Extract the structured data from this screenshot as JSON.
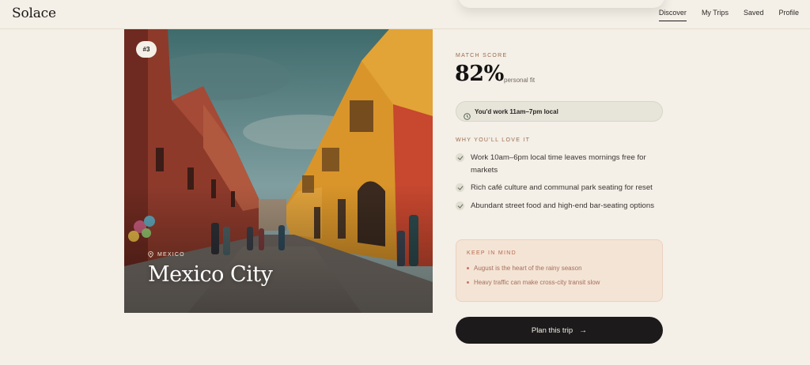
{
  "app": {
    "logo": "Solace"
  },
  "nav": [
    {
      "label": "Discover",
      "active": true
    },
    {
      "label": "My Trips",
      "active": false
    },
    {
      "label": "Saved",
      "active": false
    },
    {
      "label": "Profile",
      "active": false
    }
  ],
  "destination": {
    "rank": "#3",
    "country": "MEXICO",
    "city": "Mexico City"
  },
  "match": {
    "eyebrow": "MATCH SCORE",
    "score": "82%",
    "caption": "personal fit",
    "work_hours": "You'd work 11am–7pm local"
  },
  "why": {
    "eyebrow": "WHY YOU'LL LOVE IT",
    "reasons": [
      "Work 10am–6pm local time leaves mornings free for markets",
      "Rich café culture and communal park seating for reset",
      "Abundant street food and high-end bar-seating options"
    ]
  },
  "keep_in_mind": {
    "eyebrow": "KEEP IN MIND",
    "items": [
      "August is the heart of the rainy season",
      "Heavy traffic can make cross-city transit slow"
    ]
  },
  "cta": {
    "label": "Plan this trip",
    "icon": "arrow-right-icon"
  },
  "colors": {
    "background": "#f4efe7",
    "accent": "#b7684a",
    "dark": "#1c1a1b"
  }
}
